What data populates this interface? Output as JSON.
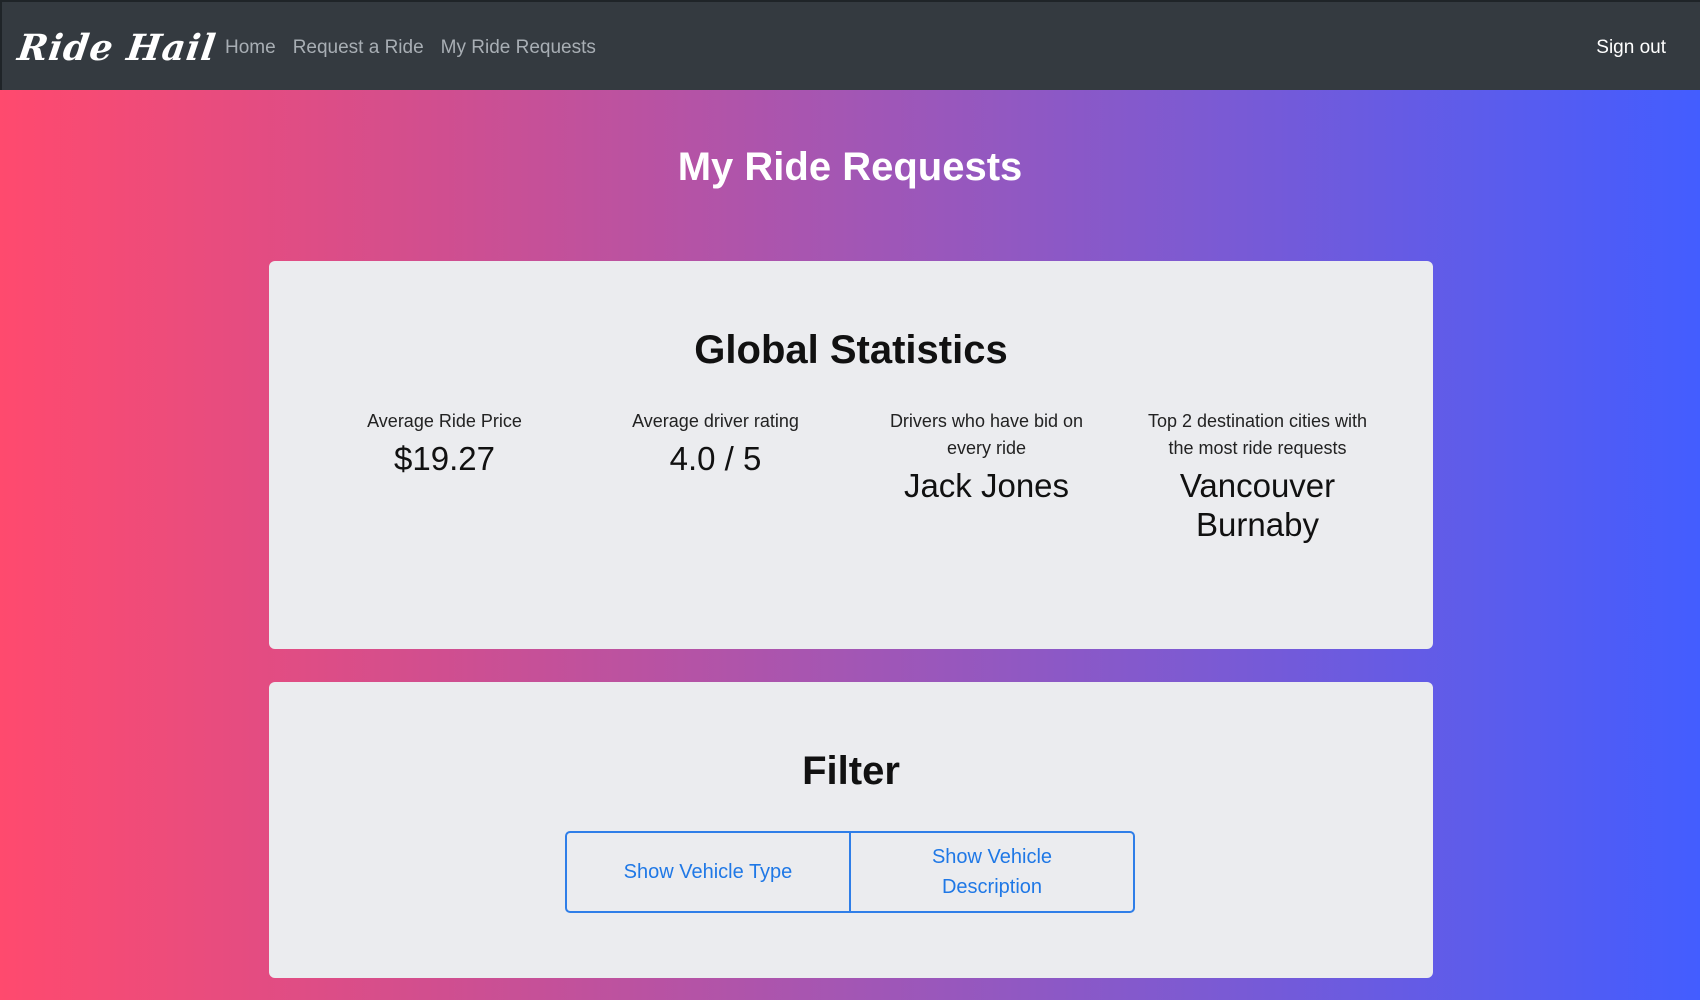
{
  "nav": {
    "brand": "Ride Hail",
    "links": [
      "Home",
      "Request a Ride",
      "My Ride Requests"
    ],
    "signout": "Sign out"
  },
  "page": {
    "title": "My Ride Requests"
  },
  "stats": {
    "title": "Global Statistics",
    "items": [
      {
        "label": "Average Ride Price",
        "value": "$19.27"
      },
      {
        "label": "Average driver rating",
        "value": "4.0 / 5"
      },
      {
        "label": "Drivers who have bid on every ride",
        "value": "Jack Jones"
      },
      {
        "label": "Top 2 destination cities with the most ride requests",
        "values": [
          "Vancouver",
          "Burnaby"
        ]
      }
    ]
  },
  "filter": {
    "title": "Filter",
    "buttons": [
      "Show Vehicle Type",
      "Show Vehicle Description"
    ]
  },
  "colors": {
    "navbar": "#343a40",
    "card": "#ebecef",
    "accent": "#1f78e6",
    "gradient_start": "#ff4a6e",
    "gradient_end": "#435dff"
  }
}
